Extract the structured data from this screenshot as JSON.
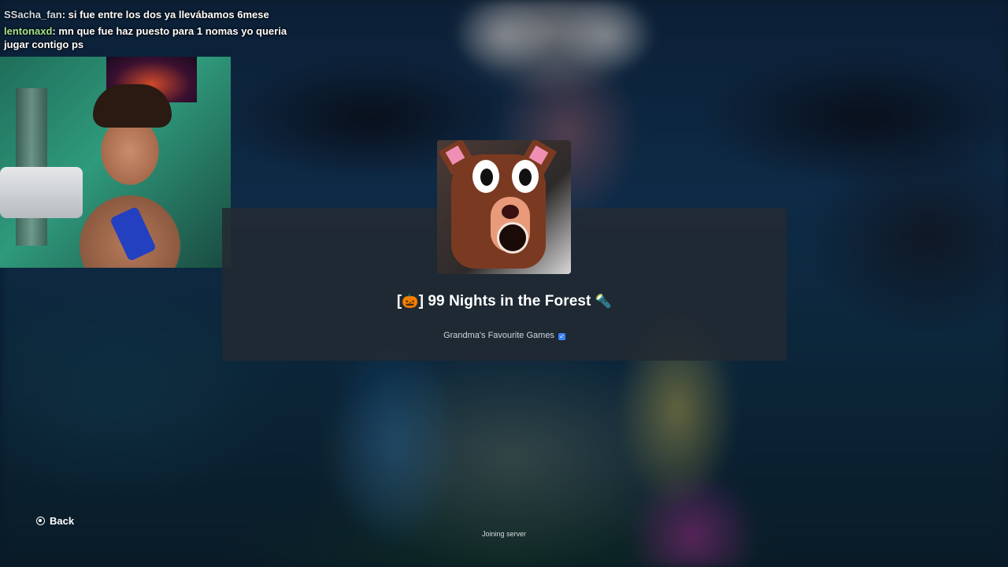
{
  "chat": [
    {
      "user": "SSacha_fan",
      "sep": ":",
      "text": "si fue entre los dos ya llevábamos 6mese"
    },
    {
      "user": "lentonaxd",
      "sep": ":",
      "text": "mn que fue haz puesto para 1 nomas yo queria jugar contigo ps"
    }
  ],
  "game": {
    "title_prefix": "[",
    "title_prefix_icon": "🎃",
    "title_main": "] 99 Nights in the Forest",
    "title_suffix_icon": "🔦",
    "creator": "Grandma's Favourite Games",
    "verified_icon": "✓"
  },
  "nav": {
    "back_label": "Back"
  },
  "status": {
    "text": "Joining server"
  },
  "colors": {
    "panel": "#232a32",
    "accent_verified": "#3b82f6",
    "user1": "#cfd8e6",
    "user2": "#a6e38c"
  }
}
